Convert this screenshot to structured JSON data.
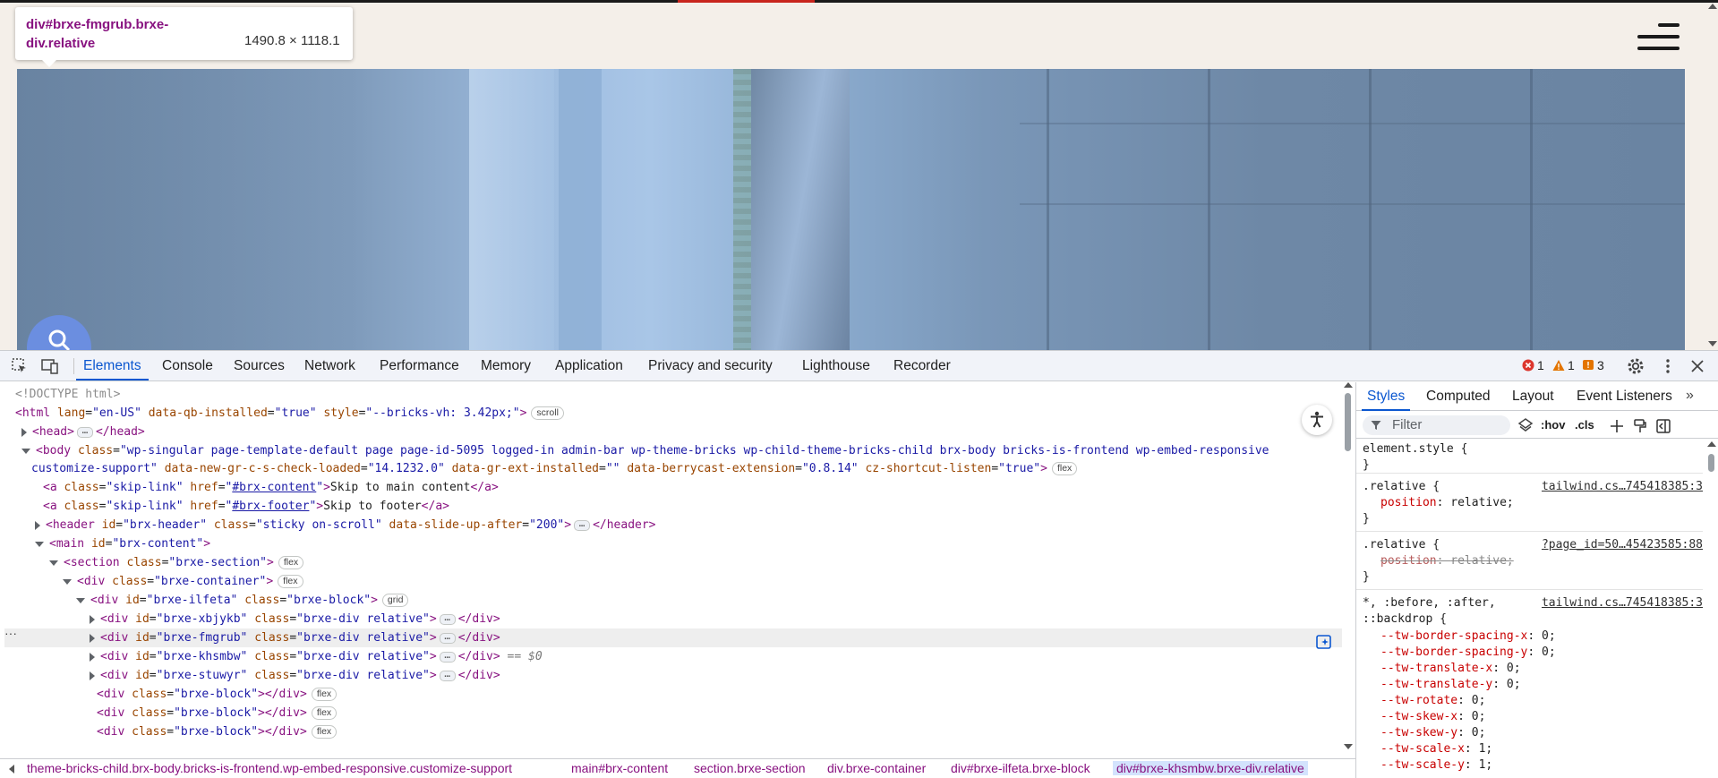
{
  "page": {
    "tooltip": {
      "element": "div#brxe-fmgrub.brxe-div.relative",
      "size": "1490.8 × 1118.1"
    }
  },
  "devtools": {
    "tabs": [
      "Elements",
      "Console",
      "Sources",
      "Network",
      "Performance",
      "Memory",
      "Application",
      "Privacy and security",
      "Lighthouse",
      "Recorder"
    ],
    "active_tab": "Elements",
    "counts": {
      "errors": "1",
      "warnings": "1",
      "issues": "3"
    },
    "colors": {
      "accent": "#0b57d0",
      "tag": "#881280",
      "attr_name": "#994500",
      "attr_value": "#1a1aa6",
      "prop_name": "#c80000"
    },
    "dom": {
      "doctype": "<!DOCTYPE html>",
      "html": {
        "tag": "<html",
        "attrs": [
          [
            "lang",
            "\"en-US\""
          ],
          [
            "data-qb-installed",
            "\"true\""
          ],
          [
            "style",
            "\"--bricks-vh: 3.42px;\""
          ]
        ],
        "pill": "scroll"
      },
      "head": {
        "open": "<head>",
        "close": "</head>"
      },
      "body_classes_1": "\"wp-singular page-template-default page page-id-5095 logged-in admin-bar wp-theme-bricks wp-child-theme-bricks-child brx-body bricks-is-frontend wp-embed-responsive",
      "body_classes_2": "customize-support\"",
      "body_attrs": [
        [
          "data-new-gr-c-s-check-loaded",
          "\"14.1232.0\""
        ],
        [
          "data-gr-ext-installed",
          "\"\""
        ],
        [
          "data-berrycast-extension",
          "\"0.8.14\""
        ],
        [
          "cz-shortcut-listen",
          "\"true\""
        ]
      ],
      "body_pill": "flex",
      "skip1": {
        "href": "#brx-content",
        "text": "Skip to main content"
      },
      "skip2": {
        "href": "#brx-footer",
        "text": "Skip to footer"
      },
      "header": {
        "id": "\"brx-header\"",
        "class": "\"sticky on-scroll\"",
        "slide": "\"200\""
      },
      "main": {
        "id": "\"brx-content\""
      },
      "section": {
        "class": "\"brxe-section\"",
        "pill": "flex"
      },
      "container": {
        "class": "\"brxe-container\"",
        "pill": "flex"
      },
      "block": {
        "id": "\"brxe-ilfeta\"",
        "class": "\"brxe-block\"",
        "pill": "grid"
      },
      "divs": [
        {
          "id": "\"brxe-xbjykb\"",
          "class": "\"brxe-div relative\""
        },
        {
          "id": "\"brxe-fmgrub\"",
          "class": "\"brxe-div relative\""
        },
        {
          "id": "\"brxe-khsmbw\"",
          "class": "\"brxe-div relative\""
        },
        {
          "id": "\"brxe-stuwyr\"",
          "class": "\"brxe-div relative\""
        }
      ],
      "dollar": "== $0",
      "blocks": [
        {
          "class": "\"brxe-block\"",
          "pill": "flex"
        },
        {
          "class": "\"brxe-block\"",
          "pill": "flex"
        },
        {
          "class": "\"brxe-block\"",
          "pill": "flex"
        }
      ]
    },
    "breadcrumbs": [
      "theme-bricks-child.brx-body.bricks-is-frontend.wp-embed-responsive.customize-support",
      "main#brx-content",
      "section.brxe-section",
      "div.brxe-container",
      "div#brxe-ilfeta.brxe-block",
      "div#brxe-khsmbw.brxe-div.relative"
    ],
    "styles_panel": {
      "tabs": [
        "Styles",
        "Computed",
        "Layout",
        "Event Listeners"
      ],
      "active_tab": "Styles",
      "more": "»",
      "filter_placeholder": "Filter",
      "hov": ":hov",
      "cls": ".cls",
      "rules": {
        "element_style": "element.style {",
        "r1_selector": ".relative {",
        "r1_source": "tailwind.cs…745418385:3",
        "r1_prop": "position",
        "r1_val": "relative;",
        "r2_selector": ".relative {",
        "r2_source": "?page_id=50…45423585:88",
        "r2_prop": "position",
        "r2_val": "relative;",
        "r3_selector": "*, :before, :after,",
        "r3_selector2": "::backdrop {",
        "r3_source": "tailwind.cs…745418385:3",
        "r3_props": [
          [
            "--tw-border-spacing-x",
            "0;"
          ],
          [
            "--tw-border-spacing-y",
            "0;"
          ],
          [
            "--tw-translate-x",
            "0;"
          ],
          [
            "--tw-translate-y",
            "0;"
          ],
          [
            "--tw-rotate",
            "0;"
          ],
          [
            "--tw-skew-x",
            "0;"
          ],
          [
            "--tw-skew-y",
            "0;"
          ],
          [
            "--tw-scale-x",
            "1;"
          ],
          [
            "--tw-scale-y",
            "1;"
          ]
        ],
        "close": "}"
      }
    }
  }
}
